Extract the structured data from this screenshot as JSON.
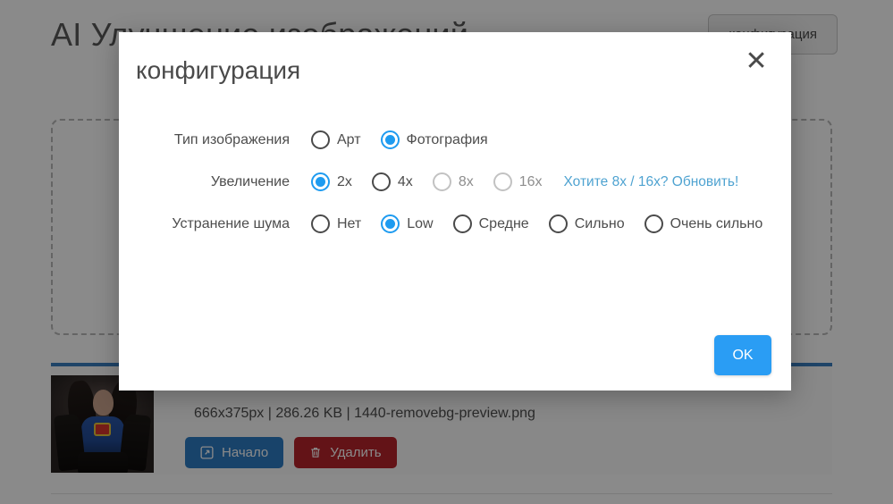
{
  "background": {
    "page_title": "AI Улучшение изображений",
    "config_button_label": "конфигурация",
    "dropzone": {
      "name": "dropzone"
    },
    "file": {
      "info": "666x375px | 286.26 KB | 1440-removebg-preview.png",
      "dimensions": "666x375px",
      "size": "286.26 KB",
      "filename": "1440-removebg-preview.png",
      "start_button_label": "Начало",
      "delete_button_label": "Удалить",
      "start_icon": "expand-icon",
      "delete_icon": "trash-icon"
    }
  },
  "modal": {
    "title": "конфигурация",
    "close_icon": "close-icon",
    "close_glyph": "✕",
    "ok_label": "OK",
    "accent_color": "#2a9df4",
    "radio_checked_color": "#1e9bf0",
    "link_color": "#4fa3d1",
    "rows": [
      {
        "key": "image_type",
        "label": "Тип изображения",
        "options": [
          {
            "label": "Арт",
            "checked": false,
            "disabled": false
          },
          {
            "label": "Фотография",
            "checked": true,
            "disabled": false
          }
        ],
        "link": null
      },
      {
        "key": "upscale",
        "label": "Увеличение",
        "options": [
          {
            "label": "2x",
            "checked": true,
            "disabled": false
          },
          {
            "label": "4x",
            "checked": false,
            "disabled": false
          },
          {
            "label": "8x",
            "checked": false,
            "disabled": true
          },
          {
            "label": "16x",
            "checked": false,
            "disabled": true
          }
        ],
        "link": "Хотите 8x / 16x? Обновить!"
      },
      {
        "key": "noise_reduction",
        "label": "Устранение шума",
        "options": [
          {
            "label": "Нет",
            "checked": false,
            "disabled": false
          },
          {
            "label": "Low",
            "checked": true,
            "disabled": false
          },
          {
            "label": "Средне",
            "checked": false,
            "disabled": false
          },
          {
            "label": "Сильно",
            "checked": false,
            "disabled": false
          },
          {
            "label": "Очень сильно",
            "checked": false,
            "disabled": false
          }
        ],
        "link": null
      }
    ]
  }
}
